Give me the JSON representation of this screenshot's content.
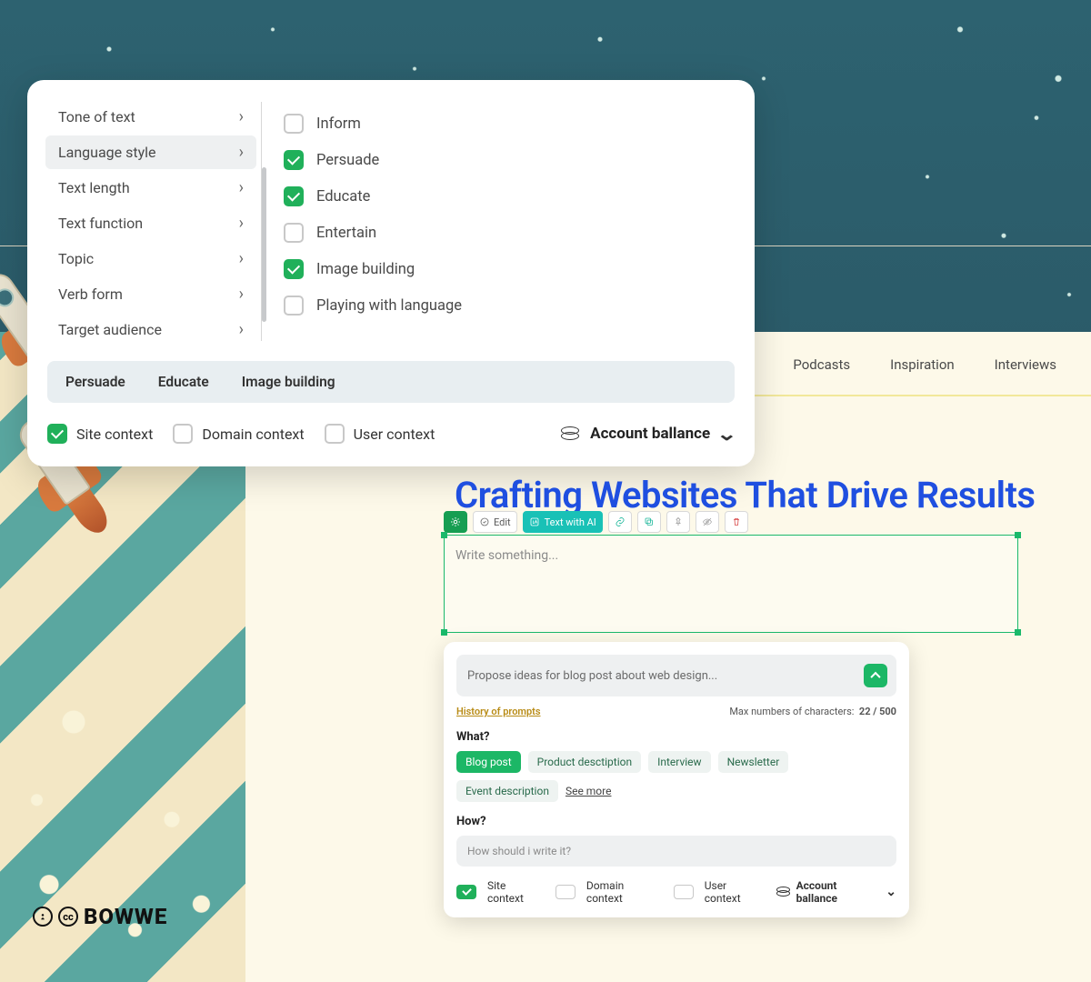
{
  "popover": {
    "sidebar": [
      {
        "label": "Tone of text",
        "active": false
      },
      {
        "label": "Language style",
        "active": true
      },
      {
        "label": "Text length",
        "active": false
      },
      {
        "label": "Text function",
        "active": false
      },
      {
        "label": "Topic",
        "active": false
      },
      {
        "label": "Verb form",
        "active": false
      },
      {
        "label": "Target audience",
        "active": false
      }
    ],
    "options": [
      {
        "label": "Inform",
        "checked": false
      },
      {
        "label": "Persuade",
        "checked": true
      },
      {
        "label": "Educate",
        "checked": true
      },
      {
        "label": "Entertain",
        "checked": false
      },
      {
        "label": "Image building",
        "checked": true
      },
      {
        "label": "Playing with language",
        "checked": false
      }
    ],
    "selected_chips": [
      "Persuade",
      "Educate",
      "Image building"
    ],
    "contexts": [
      {
        "label": "Site context",
        "checked": true
      },
      {
        "label": "Domain context",
        "checked": false
      },
      {
        "label": "User context",
        "checked": false
      }
    ],
    "balance_label": "Account ballance"
  },
  "nav": {
    "items": [
      "Podcasts",
      "Inspiration",
      "Interviews"
    ]
  },
  "headline": "Crafting Websites That Drive Results",
  "toolbar": {
    "edit": "Edit",
    "text_ai": "Text with AI"
  },
  "editor": {
    "placeholder": "Write something..."
  },
  "panel": {
    "prompt": "Propose ideas for blog post about web design...",
    "history": "History of prompts",
    "max_label": "Max numbers of characters:",
    "max_value": "22 / 500",
    "what": "What?",
    "tags": [
      {
        "label": "Blog post",
        "active": true
      },
      {
        "label": "Product desctiption",
        "active": false
      },
      {
        "label": "Interview",
        "active": false
      },
      {
        "label": "Newsletter",
        "active": false
      },
      {
        "label": "Event description",
        "active": false
      }
    ],
    "see_more": "See more",
    "how": "How?",
    "how_placeholder": "How should i write it?",
    "contexts": [
      {
        "label": "Site context",
        "checked": true
      },
      {
        "label": "Domain context",
        "checked": false
      },
      {
        "label": "User context",
        "checked": false
      }
    ],
    "balance_label": "Account ballance"
  },
  "brand": "BOWWE"
}
